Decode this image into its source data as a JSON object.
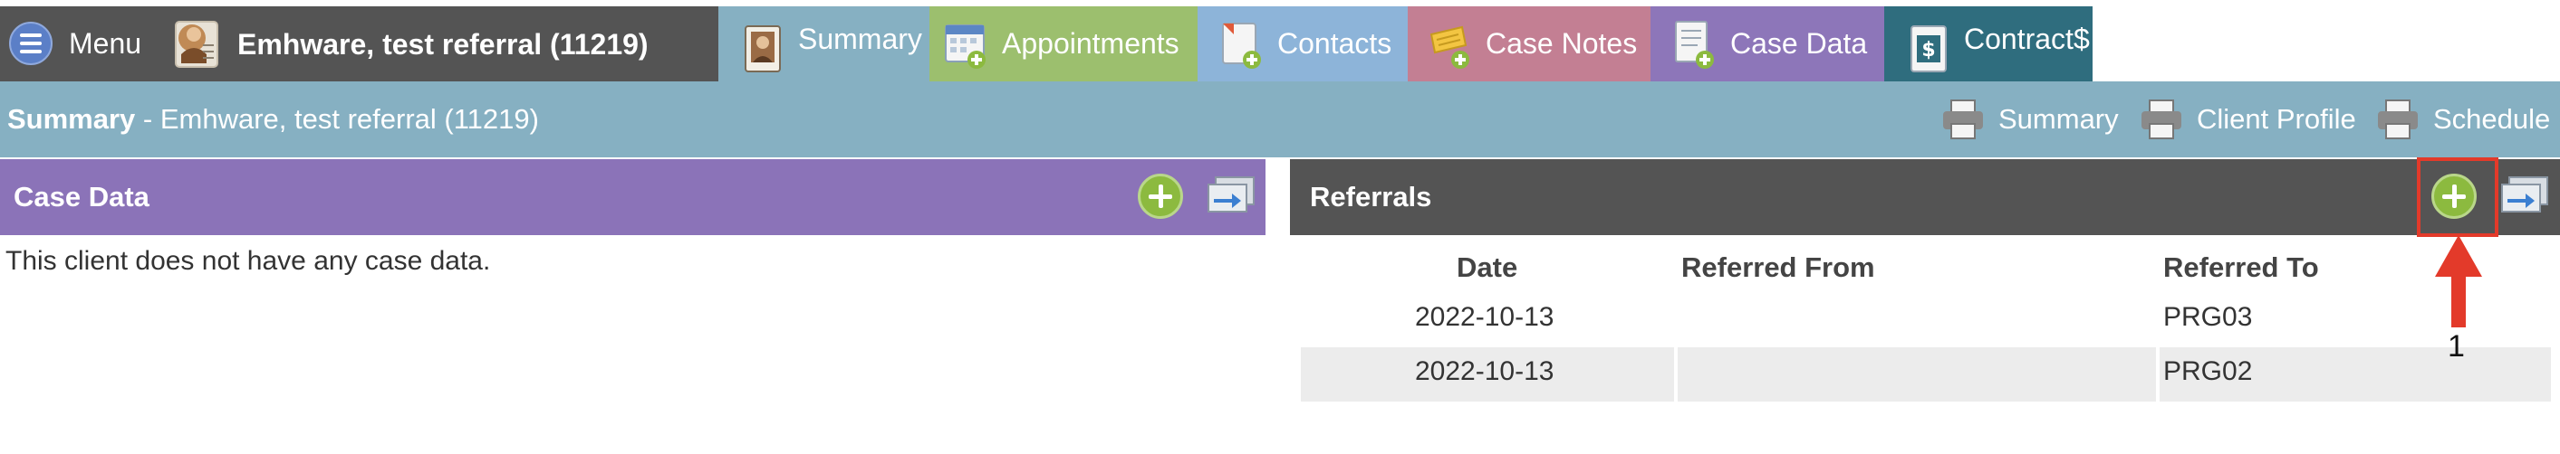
{
  "nav": {
    "menu_label": "Menu",
    "menu_icon": "hamburger-icon",
    "client_name": "Emhware, test referral (11219)",
    "client_icon": "client-avatar-icon",
    "tabs": [
      {
        "label": "Summary",
        "icon": "profile-card-icon",
        "color": "#86b0c2"
      },
      {
        "label": "Appointments",
        "icon": "calendar-add-icon",
        "color": "#9cbf6e"
      },
      {
        "label": "Contacts",
        "icon": "contact-add-icon",
        "color": "#8db4d9"
      },
      {
        "label": "Case Notes",
        "icon": "notes-add-icon",
        "color": "#c37f93"
      },
      {
        "label": "Case Data",
        "icon": "document-add-icon",
        "color": "#8d76b9"
      },
      {
        "label": "Contract$",
        "icon": "contract-dollar-icon",
        "color": "#2f6d7e"
      }
    ]
  },
  "summary_bar": {
    "title_bold": "Summary",
    "title_rest": " - Emhware, test referral (11219)",
    "print_links": [
      {
        "label": "Summary",
        "icon": "printer-icon"
      },
      {
        "label": "Client Profile",
        "icon": "printer-icon"
      },
      {
        "label": "Schedule",
        "icon": "printer-icon"
      }
    ]
  },
  "case_data": {
    "title": "Case Data",
    "empty_message": "This client does not have any case data.",
    "add_icon": "add-circle-icon",
    "link_icon": "link-window-icon"
  },
  "referrals": {
    "title": "Referrals",
    "add_icon": "add-circle-icon",
    "link_icon": "link-window-icon",
    "columns": [
      "Date",
      "Referred From",
      "Referred To"
    ],
    "rows": [
      {
        "date": "2022-10-13",
        "referred_from": "",
        "referred_to": "PRG03"
      },
      {
        "date": "2022-10-13",
        "referred_from": "",
        "referred_to": "PRG02"
      }
    ]
  },
  "annotation": {
    "number": "1",
    "color": "#e33a2a"
  },
  "colors": {
    "nav_dark": "#545454",
    "summary_blue": "#86b0c2",
    "case_data_purple": "#8b73b8",
    "add_green": "#8cba3f"
  }
}
